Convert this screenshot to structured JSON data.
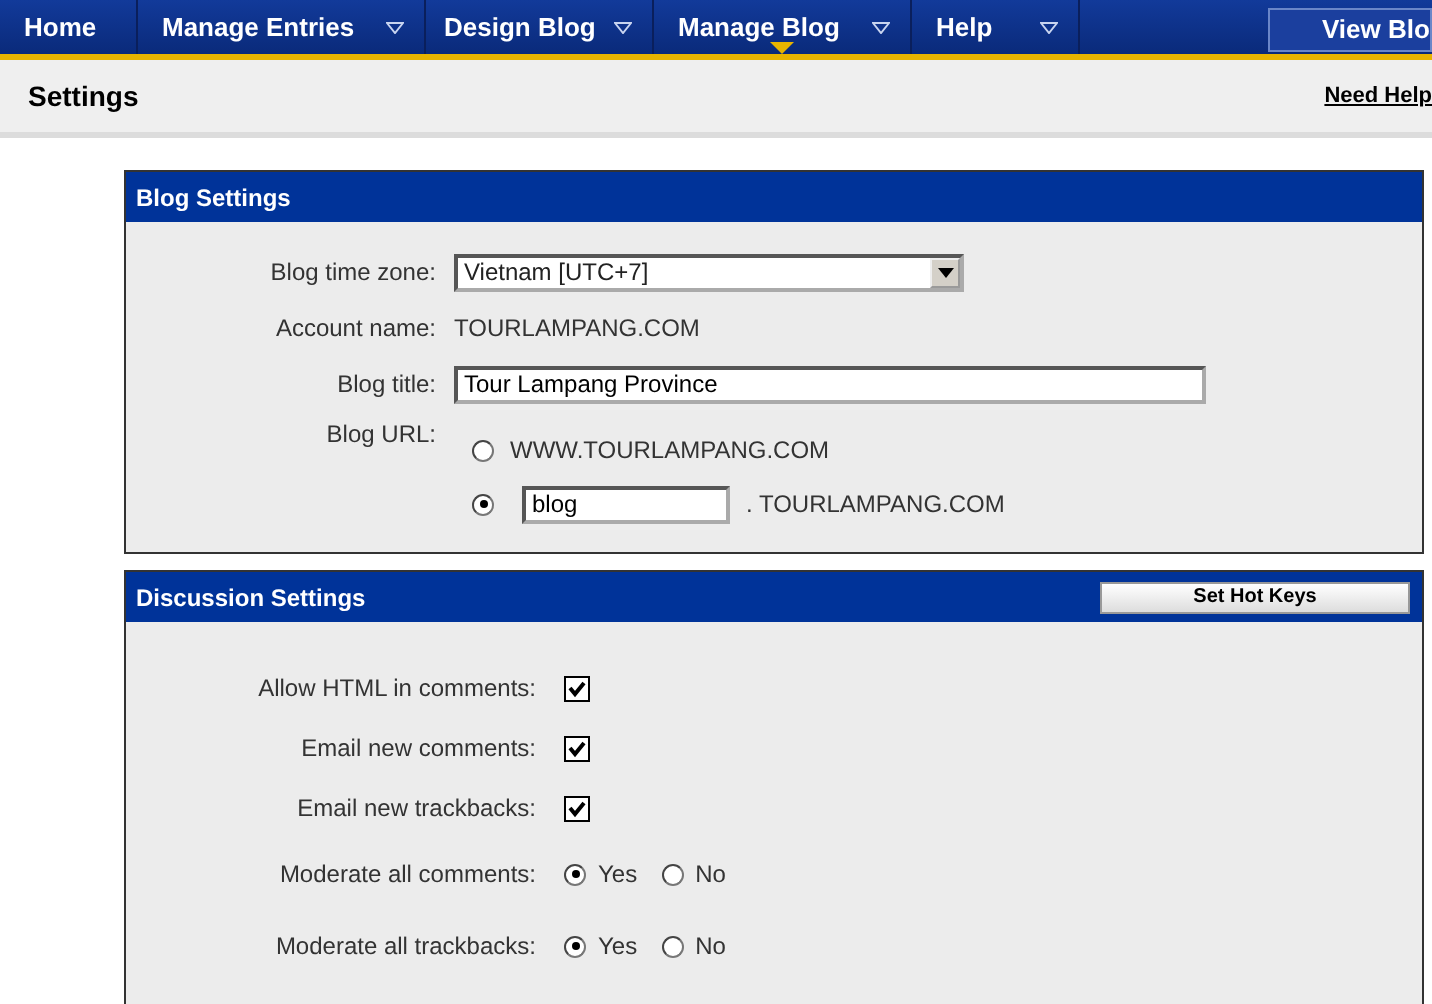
{
  "nav": {
    "items": [
      {
        "label": "Home",
        "dropdown": false,
        "selected": false
      },
      {
        "label": "Manage Entries",
        "dropdown": true,
        "selected": false
      },
      {
        "label": "Design Blog",
        "dropdown": true,
        "selected": false
      },
      {
        "label": "Manage Blog",
        "dropdown": true,
        "selected": true
      },
      {
        "label": "Help",
        "dropdown": true,
        "selected": false
      }
    ],
    "view_button": "View Blo"
  },
  "page": {
    "title": "Settings",
    "help_link": "Need Help"
  },
  "blog_settings": {
    "title": "Blog Settings",
    "time_zone": {
      "label": "Blog time zone:",
      "value": "Vietnam [UTC+7]"
    },
    "account": {
      "label": "Account name:",
      "value": "TOURLAMPANG.COM"
    },
    "blog_title": {
      "label": "Blog title:",
      "value": "Tour Lampang Province"
    },
    "blog_url": {
      "label": "Blog URL:",
      "options": [
        {
          "text": "WWW.TOURLAMPANG.COM",
          "selected": false
        },
        {
          "value": "blog",
          "suffix": ". TOURLAMPANG.COM",
          "selected": true
        }
      ]
    }
  },
  "discussion_settings": {
    "title": "Discussion Settings",
    "button": "Set Hot Keys",
    "rows": [
      {
        "kind": "checkbox",
        "label": "Allow HTML in comments:",
        "checked": true
      },
      {
        "kind": "checkbox",
        "label": "Email new comments:",
        "checked": true
      },
      {
        "kind": "checkbox",
        "label": "Email new trackbacks:",
        "checked": true
      },
      {
        "kind": "radio",
        "label": "Moderate all comments:",
        "options": [
          {
            "label": "Yes",
            "selected": true
          },
          {
            "label": "No",
            "selected": false
          }
        ]
      },
      {
        "kind": "radio",
        "label": "Moderate all trackbacks:",
        "options": [
          {
            "label": "Yes",
            "selected": true
          },
          {
            "label": "No",
            "selected": false
          }
        ]
      }
    ]
  }
}
